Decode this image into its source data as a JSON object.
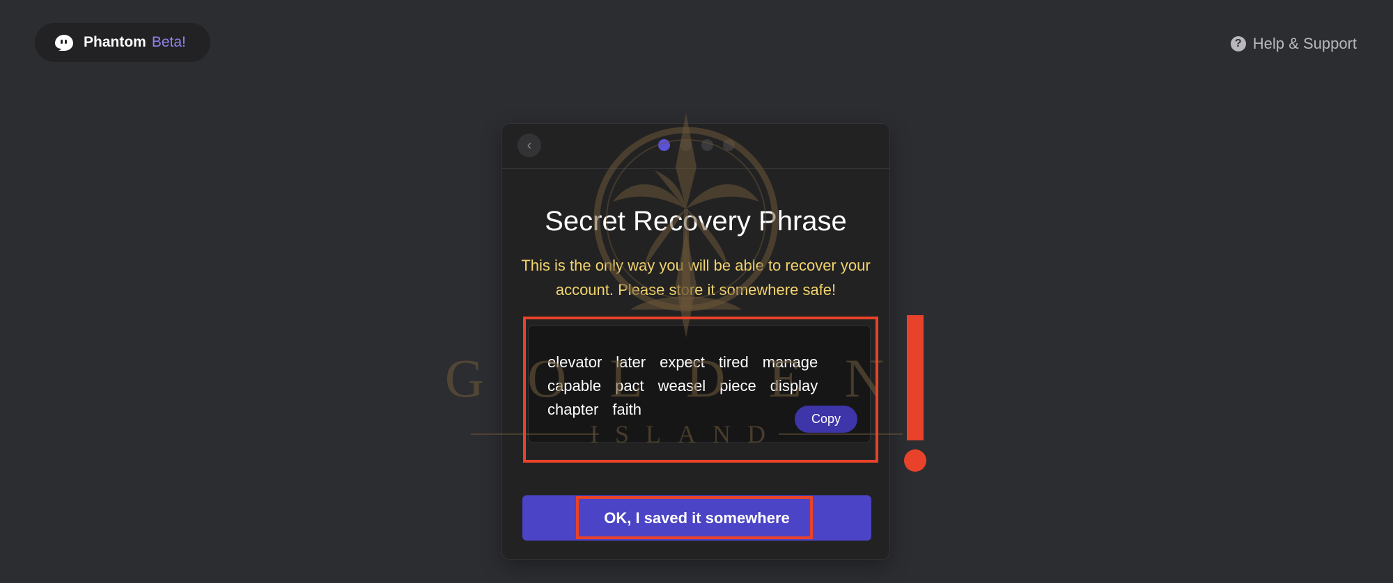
{
  "header": {
    "brand_name": "Phantom",
    "brand_badge": "Beta!",
    "brand_icon": "ghost-icon",
    "help_label": "Help & Support",
    "help_icon": "question-circle-icon"
  },
  "card": {
    "back_icon": "chevron-left-icon",
    "steps_total": 4,
    "step_current": 1,
    "title": "Secret Recovery Phrase",
    "subtitle": "This is the only way you will be able to recover your account. Please store it somewhere safe!",
    "phrase_words": [
      "elevator",
      "later",
      "expect",
      "tired",
      "manage",
      "capable",
      "pact",
      "weasel",
      "piece",
      "display",
      "chapter",
      "faith"
    ],
    "copy_label": "Copy",
    "confirm_label": "OK, I saved it somewhere"
  },
  "watermark": {
    "line1": "GOLDEN",
    "line2": "ISLAND"
  },
  "colors": {
    "accent": "#4c44c6",
    "warning_text": "#f2d46c",
    "annotation": "#e8432a",
    "background": "#2c2d31"
  }
}
